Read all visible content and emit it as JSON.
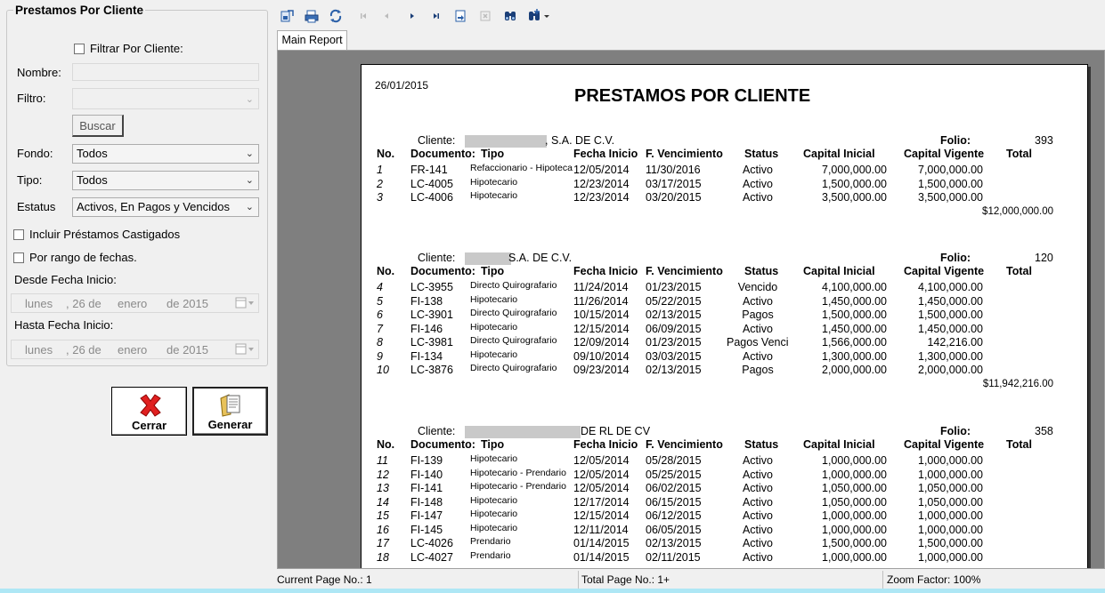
{
  "left_panel": {
    "group_title": "Prestamos Por Cliente",
    "filter_by_client_label": "Filtrar Por Cliente:",
    "name_label": "Nombre:",
    "filter_label": "Filtro:",
    "search_button": "Buscar",
    "fund_label": "Fondo:",
    "fund_value": "Todos",
    "type_label": "Tipo:",
    "type_value": "Todos",
    "status_label": "Estatus",
    "status_value": "Activos, En Pagos y Vencidos",
    "include_written_off_label": "Incluir Préstamos Castigados",
    "date_range_label": "Por rango de fechas.",
    "from_date_label": "Desde Fecha Inicio:",
    "to_date_label": "Hasta Fecha Inicio:",
    "from_date": {
      "day_name": "lunes",
      "day": ", 26 de",
      "month": "enero",
      "year": "de 2015"
    },
    "to_date": {
      "day_name": "lunes",
      "day": ", 26 de",
      "month": "enero",
      "year": "de 2015"
    },
    "close_button": "Cerrar",
    "generate_button": "Generar"
  },
  "viewer": {
    "tab_label": "Main Report",
    "status": {
      "current_page": "Current Page No.: 1",
      "total_pages": "Total Page No.: 1+",
      "zoom": "Zoom Factor: 100%"
    }
  },
  "report": {
    "date": "26/01/2015",
    "title": "PRESTAMOS POR CLIENTE",
    "columns": {
      "no": "No.",
      "doc": "Documento:",
      "tipo": "Tipo",
      "fecha": "Fecha Inicio",
      "venc": "F. Vencimiento",
      "status": "Status",
      "cap_ini": "Capital Inicial",
      "cap_vig": "Capital Vigente",
      "total": "Total"
    },
    "client_label": "Cliente:",
    "folio_label": "Folio:",
    "clients": [
      {
        "name_suffix": ", S.A. DE C.V.",
        "folio": "393",
        "total": "$12,000,000.00",
        "rows": [
          {
            "no": "1",
            "doc": "FR-141",
            "tipo": "Refaccionario - Hipoteca",
            "fecha": "12/05/2014",
            "venc": "11/30/2016",
            "status": "Activo",
            "ci": "7,000,000.00",
            "cv": "7,000,000.00"
          },
          {
            "no": "2",
            "doc": "LC-4005",
            "tipo": "Hipotecario",
            "fecha": "12/23/2014",
            "venc": "03/17/2015",
            "status": "Activo",
            "ci": "1,500,000.00",
            "cv": "1,500,000.00"
          },
          {
            "no": "3",
            "doc": "LC-4006",
            "tipo": "Hipotecario",
            "fecha": "12/23/2014",
            "venc": "03/20/2015",
            "status": "Activo",
            "ci": "3,500,000.00",
            "cv": "3,500,000.00"
          }
        ]
      },
      {
        "name_suffix": "S.A. DE C.V.",
        "folio": "120",
        "total": "$11,942,216.00",
        "rows": [
          {
            "no": "4",
            "doc": "LC-3955",
            "tipo": "Directo Quirografario",
            "fecha": "11/24/2014",
            "venc": "01/23/2015",
            "status": "Vencido",
            "ci": "4,100,000.00",
            "cv": "4,100,000.00"
          },
          {
            "no": "5",
            "doc": "FI-138",
            "tipo": "Hipotecario",
            "fecha": "11/26/2014",
            "venc": "05/22/2015",
            "status": "Activo",
            "ci": "1,450,000.00",
            "cv": "1,450,000.00"
          },
          {
            "no": "6",
            "doc": "LC-3901",
            "tipo": "Directo Quirografario",
            "fecha": "10/15/2014",
            "venc": "02/13/2015",
            "status": "Pagos",
            "ci": "1,500,000.00",
            "cv": "1,500,000.00"
          },
          {
            "no": "7",
            "doc": "FI-146",
            "tipo": "Hipotecario",
            "fecha": "12/15/2014",
            "venc": "06/09/2015",
            "status": "Activo",
            "ci": "1,450,000.00",
            "cv": "1,450,000.00"
          },
          {
            "no": "8",
            "doc": "LC-3981",
            "tipo": "Directo Quirografario",
            "fecha": "12/09/2014",
            "venc": "01/23/2015",
            "status": "Pagos Vencic",
            "ci": "1,566,000.00",
            "cv": "142,216.00"
          },
          {
            "no": "9",
            "doc": "FI-134",
            "tipo": "Hipotecario",
            "fecha": "09/10/2014",
            "venc": "03/03/2015",
            "status": "Activo",
            "ci": "1,300,000.00",
            "cv": "1,300,000.00"
          },
          {
            "no": "10",
            "doc": "LC-3876",
            "tipo": "Directo Quirografario",
            "fecha": "09/23/2014",
            "venc": "02/13/2015",
            "status": "Pagos",
            "ci": "2,000,000.00",
            "cv": "2,000,000.00"
          }
        ]
      },
      {
        "name_suffix": "DE RL DE CV",
        "folio": "358",
        "total": "",
        "rows": [
          {
            "no": "11",
            "doc": "FI-139",
            "tipo": "Hipotecario",
            "fecha": "12/05/2014",
            "venc": "05/28/2015",
            "status": "Activo",
            "ci": "1,000,000.00",
            "cv": "1,000,000.00"
          },
          {
            "no": "12",
            "doc": "FI-140",
            "tipo": "Hipotecario - Prendario",
            "fecha": "12/05/2014",
            "venc": "05/25/2015",
            "status": "Activo",
            "ci": "1,000,000.00",
            "cv": "1,000,000.00"
          },
          {
            "no": "13",
            "doc": "FI-141",
            "tipo": "Hipotecario - Prendario",
            "fecha": "12/05/2014",
            "venc": "06/02/2015",
            "status": "Activo",
            "ci": "1,050,000.00",
            "cv": "1,050,000.00"
          },
          {
            "no": "14",
            "doc": "FI-148",
            "tipo": "Hipotecario",
            "fecha": "12/17/2014",
            "venc": "06/15/2015",
            "status": "Activo",
            "ci": "1,050,000.00",
            "cv": "1,050,000.00"
          },
          {
            "no": "15",
            "doc": "FI-147",
            "tipo": "Hipotecario",
            "fecha": "12/15/2014",
            "venc": "06/12/2015",
            "status": "Activo",
            "ci": "1,000,000.00",
            "cv": "1,000,000.00"
          },
          {
            "no": "16",
            "doc": "FI-145",
            "tipo": "Hipotecario",
            "fecha": "12/11/2014",
            "venc": "06/05/2015",
            "status": "Activo",
            "ci": "1,000,000.00",
            "cv": "1,000,000.00"
          },
          {
            "no": "17",
            "doc": "LC-4026",
            "tipo": "Prendario",
            "fecha": "01/14/2015",
            "venc": "02/13/2015",
            "status": "Activo",
            "ci": "1,500,000.00",
            "cv": "1,500,000.00"
          },
          {
            "no": "18",
            "doc": "LC-4027",
            "tipo": "Prendario",
            "fecha": "01/14/2015",
            "venc": "02/11/2015",
            "status": "Activo",
            "ci": "1,000,000.00",
            "cv": "1,000,000.00"
          }
        ]
      }
    ]
  }
}
